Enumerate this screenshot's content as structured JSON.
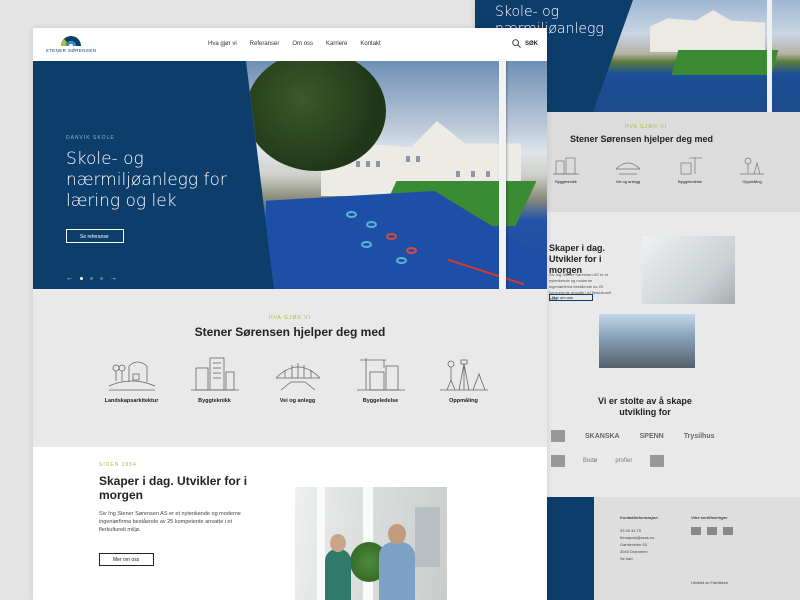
{
  "back": {
    "hero_title": "Skole- og nærmiljøanlegg for",
    "kicker": "HVA GJØR VI",
    "heading": "Stener Sørensen hjelper deg med",
    "icons": [
      "Byggteknikk",
      "Vei og anlegg",
      "Byggeledelse",
      "Oppmåling"
    ],
    "sec2_title": "Skaper i dag. Utvikler for i morgen",
    "sec2_text": "Siv Ing Stener Sørensen AS er et nytenkende og moderne ingeniørfirma bestående av 25 kompetente ansatte i et flerkulturelt miljø.",
    "sec2_btn": "Mer om oss",
    "proud": "Vi er stolte av å skape utvikling for",
    "logos_row1": [
      "SKANSKA",
      "SPENN",
      "Trysilhus"
    ],
    "logos_row2": [
      "",
      "Bodø",
      "profier",
      ""
    ],
    "footer_contact_title": "Kontaktinformasjon",
    "footer_contact": [
      "33 26 44 70",
      "firmapost@ssas.no",
      "Gamleveien 53",
      "3043 Drammen",
      "Se kart"
    ],
    "footer_cert_title": "Våre sertifiseringer",
    "footer_credit": "Utviklet av Fabrikken"
  },
  "header": {
    "logo_text": "STENER SØRENSEN",
    "nav": [
      "Hva gjør vi",
      "Referanser",
      "Om oss",
      "Karriere",
      "Kontakt"
    ],
    "search_label": "SØK"
  },
  "hero": {
    "kicker": "DANVIK SKOLE",
    "title": "Skole- og nærmiljøanlegg for læring og lek",
    "button": "Se referanse",
    "prev": "←",
    "next": "→"
  },
  "services": {
    "kicker": "HVA GJØR VI",
    "title": "Stener Sørensen hjelper deg med",
    "items": [
      "Landskapsarkitektur",
      "Byggteknikk",
      "Vei og anlegg",
      "Byggeledelse",
      "Oppmåling"
    ]
  },
  "about": {
    "kicker": "SIDEN 1954",
    "title": "Skaper i dag. Utvikler for i morgen",
    "text": "Siv Ing Stener Sørensen AS er et nytenkende og moderne ingeniørfirma bestående av 25 kompetente ansatte i et flerkulturelt miljø.",
    "button": "Mer om oss"
  },
  "colors": {
    "brand_blue": "#0c3d6b",
    "accent_green": "#a6c23a"
  }
}
